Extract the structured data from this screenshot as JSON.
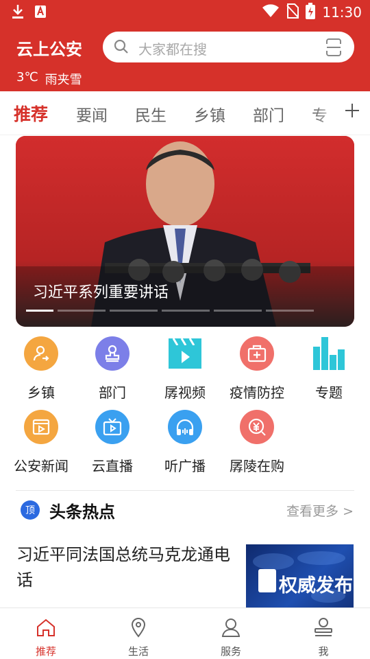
{
  "status_bar": {
    "time": "11:30"
  },
  "header": {
    "app_title": "云上公安",
    "search_placeholder": "大家都在搜",
    "temperature": "3℃",
    "weather": "雨夹雪"
  },
  "tabs": [
    {
      "label": "推荐",
      "active": true
    },
    {
      "label": "要闻"
    },
    {
      "label": "民生"
    },
    {
      "label": "乡镇"
    },
    {
      "label": "部门"
    },
    {
      "label": "专"
    }
  ],
  "banner": {
    "caption": "习近平系列重要讲话",
    "slides": 6,
    "current": 1
  },
  "quick_links": [
    {
      "label": "乡镇",
      "icon": "person-arrow-icon",
      "color": "#f4a640"
    },
    {
      "label": "部门",
      "icon": "stamp-icon",
      "color": "#7c7fe8"
    },
    {
      "label": "孱视频",
      "icon": "video-clapper-icon",
      "color": "#2ec6d8"
    },
    {
      "label": "疫情防控",
      "icon": "medical-kit-icon",
      "color": "#f0706a"
    },
    {
      "label": "专题",
      "icon": "bar-chart-icon",
      "color": "#2ec6d8"
    },
    {
      "label": "公安新闻",
      "icon": "news-video-icon",
      "color": "#f4a640"
    },
    {
      "label": "云直播",
      "icon": "tv-icon",
      "color": "#3aa0f0"
    },
    {
      "label": "听广播",
      "icon": "headphones-icon",
      "color": "#3aa0f0"
    },
    {
      "label": "孱陵在购",
      "icon": "yuan-coin-icon",
      "color": "#f0706a"
    }
  ],
  "hot": {
    "badge": "顶",
    "title": "头条热点",
    "more": "查看更多 >"
  },
  "news": [
    {
      "title": "习近平同法国总统马克龙通电话",
      "thumb_text": "权威发布"
    }
  ],
  "bottom_nav": [
    {
      "label": "推荐",
      "icon": "home-icon",
      "active": true
    },
    {
      "label": "生活",
      "icon": "location-pin-icon"
    },
    {
      "label": "服务",
      "icon": "person-icon"
    },
    {
      "label": "我",
      "icon": "profile-icon"
    }
  ],
  "colors": {
    "brand_red": "#d6312a"
  }
}
